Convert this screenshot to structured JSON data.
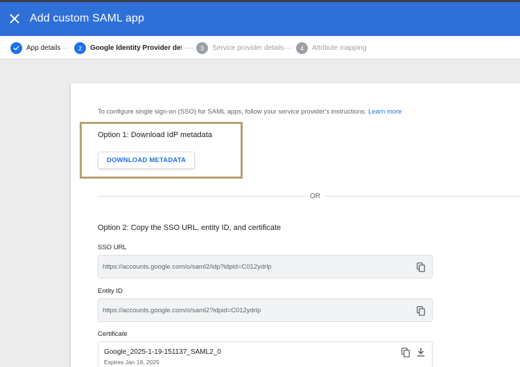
{
  "header": {
    "title": "Add custom SAML app",
    "close_icon": "close-icon",
    "background": "#2f6fd8"
  },
  "stepper": {
    "steps": [
      {
        "number": "",
        "label": "App details",
        "state": "done"
      },
      {
        "number": "2",
        "label": "Google Identity Provider details",
        "state": "active"
      },
      {
        "number": "3",
        "label": "Service provider details",
        "state": "pending"
      },
      {
        "number": "4",
        "label": "Attribute mapping",
        "state": "pending"
      }
    ]
  },
  "main": {
    "intro_text": "To configure single sign-on (SSO) for SAML apps, follow your service provider's instructions.",
    "learn_more": "Learn more",
    "option1_title": "Option 1: Download IdP metadata",
    "download_button": "DOWNLOAD METADATA",
    "or_text": "OR",
    "option2_title": "Option 2: Copy the SSO URL, entity ID, and certificate",
    "sso_url_label": "SSO URL",
    "sso_url_value": "https://accounts.google.com/o/saml2/idp?idpid=C012ydrlp",
    "entity_id_label": "Entity ID",
    "entity_id_value": "https://accounts.google.com/o/saml2?idpid=C012ydrlp",
    "certificate_label": "Certificate",
    "certificate_name": "Google_2025-1-19-151137_SAML2_0",
    "certificate_expiry": "Expires Jan 19, 2025"
  },
  "colors": {
    "accent": "#1a73e8",
    "highlight_border": "#b6a16e"
  }
}
